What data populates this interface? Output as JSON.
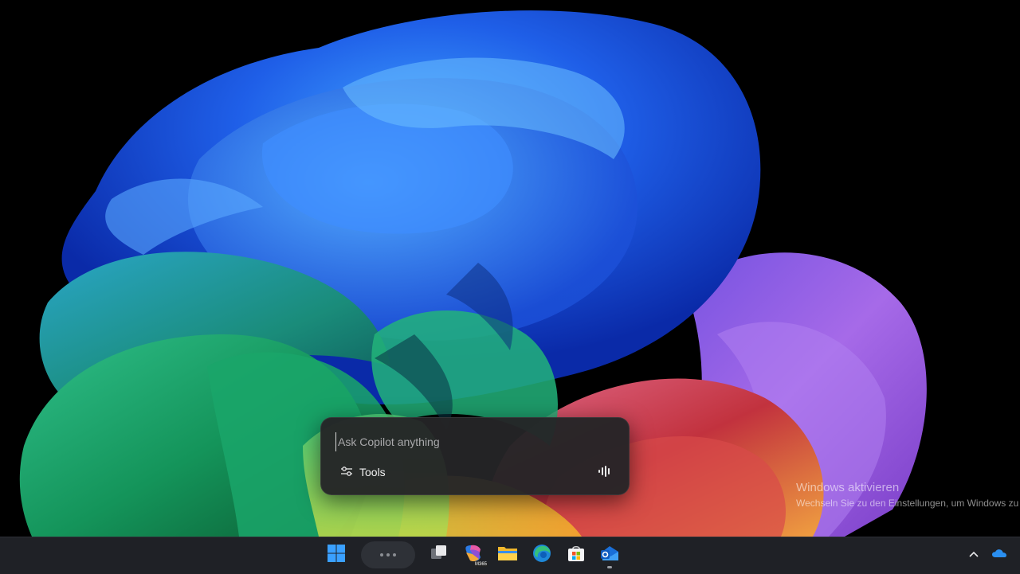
{
  "copilot": {
    "input_value": "",
    "input_placeholder": "Ask Copilot anything",
    "tools_label": "Tools"
  },
  "watermark": {
    "title": "Windows aktivieren",
    "subtitle": "Wechseln Sie zu den Einstellungen, um Windows zu a"
  },
  "taskbar": {
    "items": [
      {
        "name": "start-icon"
      },
      {
        "name": "widgets-icon"
      },
      {
        "name": "task-view-icon"
      },
      {
        "name": "m365-copilot-icon",
        "badge": "M365"
      },
      {
        "name": "file-explorer-icon"
      },
      {
        "name": "edge-icon"
      },
      {
        "name": "microsoft-store-icon"
      },
      {
        "name": "outlook-icon"
      }
    ],
    "tray": [
      {
        "name": "chevron-up-icon"
      },
      {
        "name": "onedrive-icon"
      }
    ]
  },
  "colors": {
    "taskbar_bg": "#1f2126",
    "copilot_bg": "#242426",
    "accent_blue": "#1e7be6"
  }
}
